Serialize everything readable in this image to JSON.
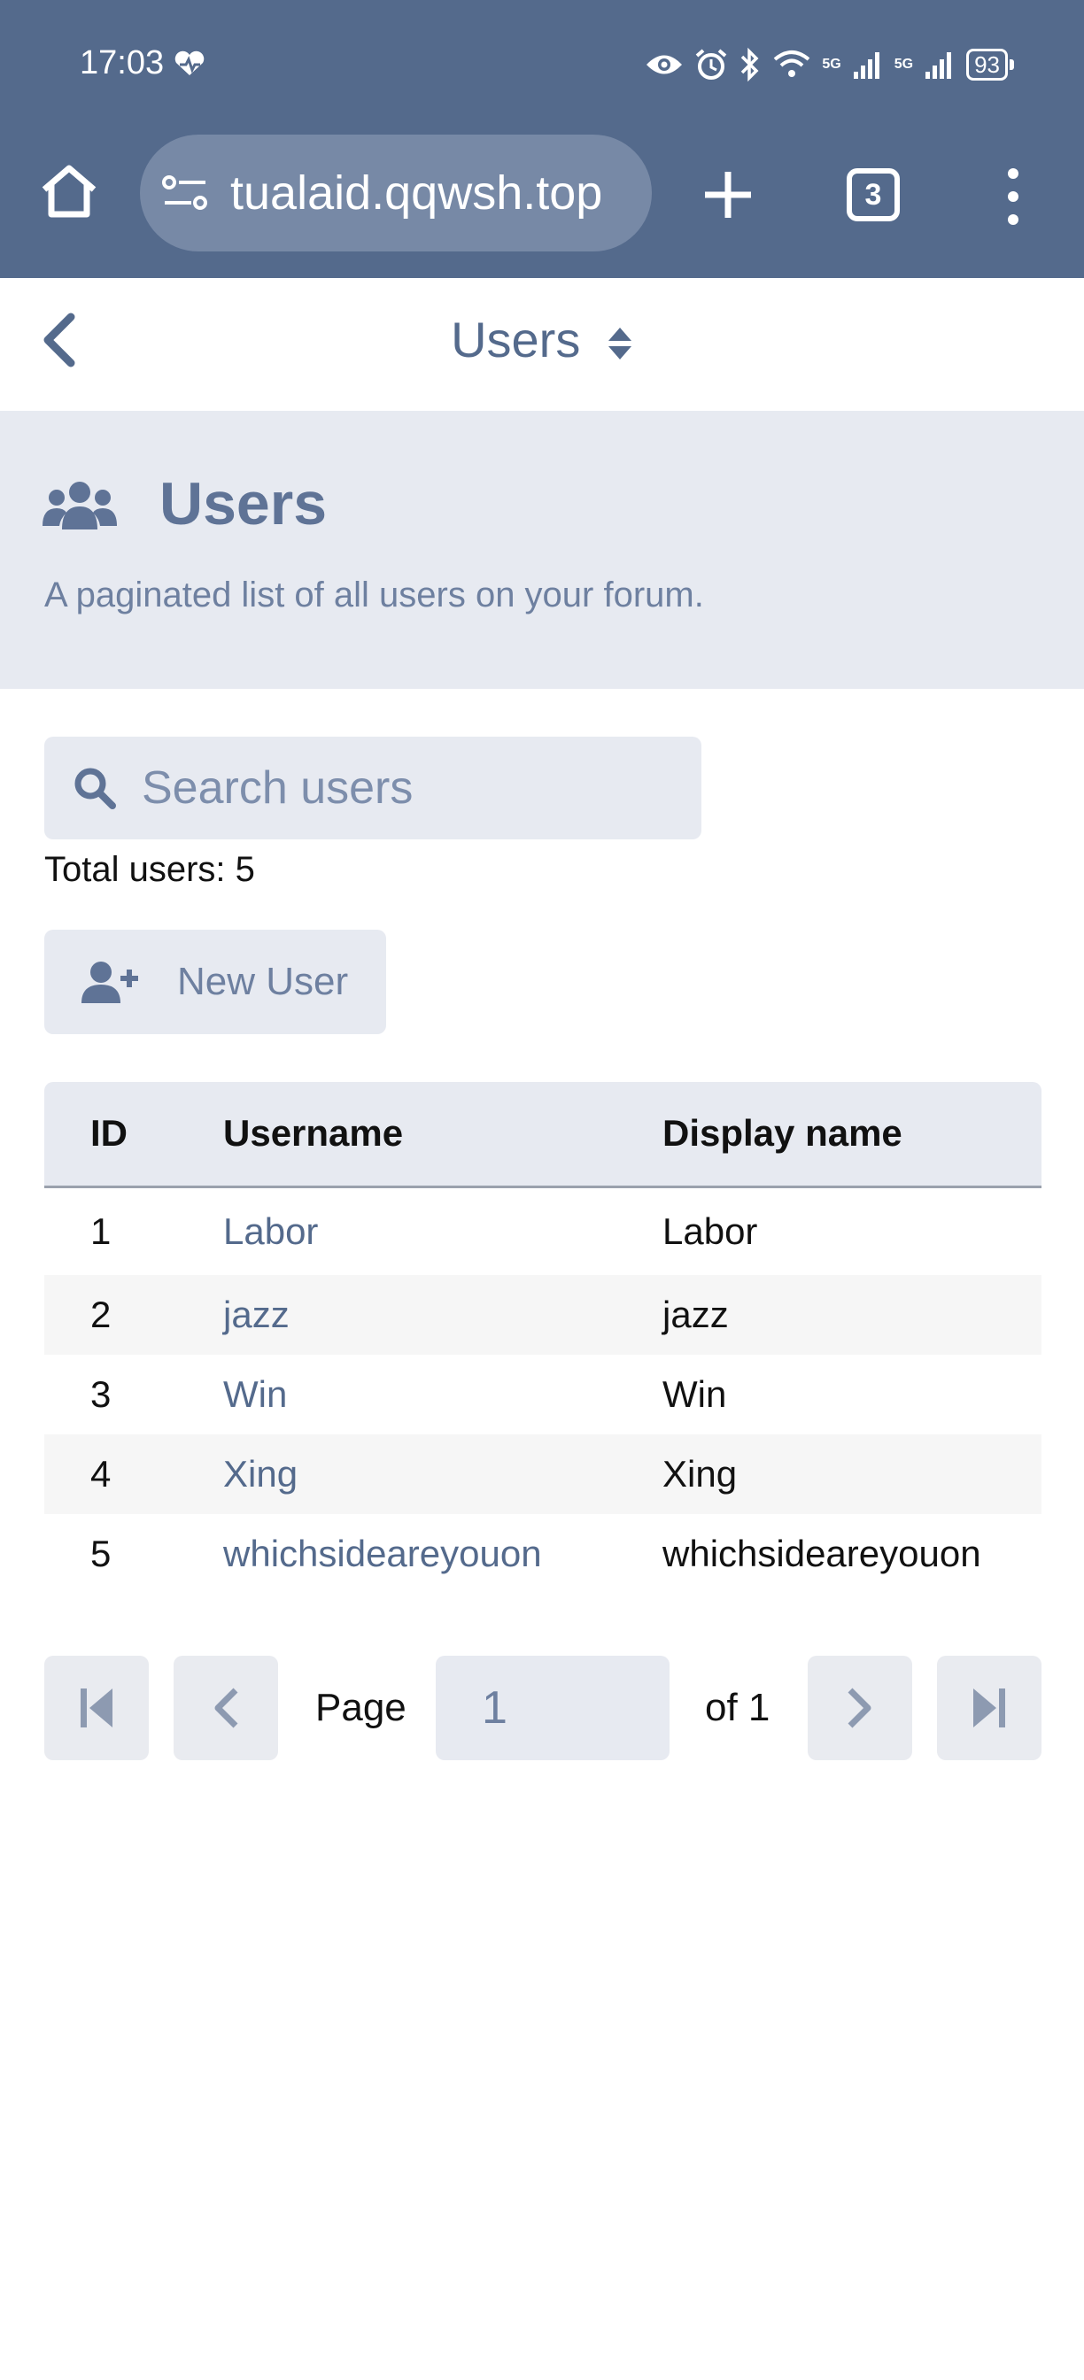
{
  "status_bar": {
    "time": "17:03",
    "battery": "93",
    "net_label_1": "5G",
    "net_label_2": "5G"
  },
  "browser": {
    "url": "tualaid.qqwsh.top",
    "tab_count": "3"
  },
  "app_bar": {
    "title": "Users"
  },
  "hero": {
    "title": "Users",
    "description": "A paginated list of all users on your forum."
  },
  "search": {
    "placeholder": "Search users",
    "value": ""
  },
  "total_users": "Total users: 5",
  "new_user_button": "New User",
  "table": {
    "headers": [
      "ID",
      "Username",
      "Display name"
    ],
    "rows": [
      {
        "id": "1",
        "username": "Labor",
        "display_name": "Labor"
      },
      {
        "id": "2",
        "username": "jazz",
        "display_name": "jazz"
      },
      {
        "id": "3",
        "username": "Win",
        "display_name": "Win"
      },
      {
        "id": "4",
        "username": "Xing",
        "display_name": "Xing"
      },
      {
        "id": "5",
        "username": "whichsideareyouon",
        "display_name": "whichsideareyouon"
      }
    ]
  },
  "pagination": {
    "page_label": "Page",
    "current_page": "1",
    "of_label": "of 1"
  },
  "colors": {
    "header_bg": "#546a8c",
    "accent": "#546a8c",
    "panel_bg": "#e7eaf1",
    "muted_text": "#6e80a0"
  }
}
